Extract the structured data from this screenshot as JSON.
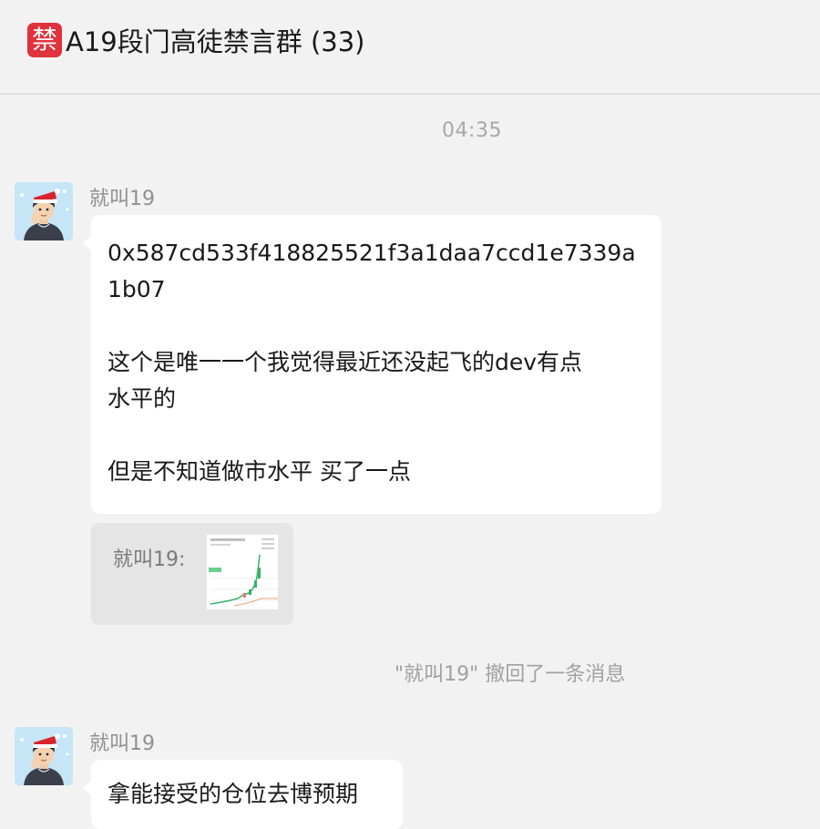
{
  "header": {
    "badge_char": "禁",
    "title": "A19段门高徒禁言群 (33)"
  },
  "timeline": {
    "timestamp": "04:35"
  },
  "messages": [
    {
      "sender": "就叫19",
      "avatar_icon": "cartoon-avatar-santa-hat",
      "lines": [
        "0x587cd533f418825521f3a1daa7ccd1e7339a",
        "1b07",
        "",
        "这个是唯一一个我觉得最近还没起飞的dev有点",
        "水平的",
        "",
        "但是不知道做市水平 买了一点"
      ],
      "quote": {
        "name": "就叫19:",
        "thumbnail_icon": "chart-screenshot-thumbnail"
      }
    },
    {
      "sender": "就叫19",
      "avatar_icon": "cartoon-avatar-santa-hat",
      "text": "拿能接受的仓位去博预期"
    }
  ],
  "system_note": "\"就叫19\" 撤回了一条消息",
  "colors": {
    "background": "#f2f2f2",
    "bubble": "#ffffff",
    "quote_background": "#e5e5e5",
    "ban_badge": "#e0323c",
    "muted_text": "#a0a0a0"
  }
}
